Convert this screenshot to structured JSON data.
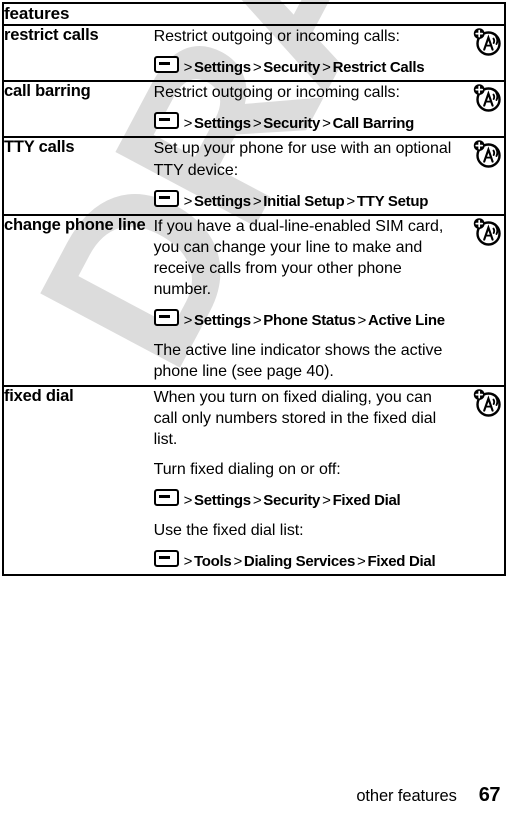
{
  "document": {
    "watermark": "DRAFT",
    "watermark_color": "#dcdcdc",
    "text_color": "#000000",
    "background_color": "#ffffff"
  },
  "table": {
    "header": {
      "label": "features"
    },
    "rows": [
      {
        "feature": "restrict calls",
        "icon": "network-a-indicator-icon",
        "blocks": [
          {
            "kind": "text",
            "text": "Restrict outgoing or incoming calls:"
          },
          {
            "kind": "path",
            "crumbs": [
              "Settings",
              "Security",
              "Restrict Calls"
            ]
          }
        ]
      },
      {
        "feature": "call barring",
        "icon": "network-a-indicator-icon",
        "blocks": [
          {
            "kind": "text",
            "text": "Restrict outgoing or incoming calls:"
          },
          {
            "kind": "path",
            "crumbs": [
              "Settings",
              "Security",
              "Call Barring"
            ]
          }
        ]
      },
      {
        "feature": "TTY calls",
        "icon": "network-a-indicator-icon",
        "blocks": [
          {
            "kind": "text",
            "text": "Set up your phone for use with an optional TTY device:"
          },
          {
            "kind": "path",
            "crumbs": [
              "Settings",
              "Initial Setup",
              "TTY Setup"
            ]
          }
        ]
      },
      {
        "feature": "change phone line",
        "icon": "network-a-indicator-icon",
        "blocks": [
          {
            "kind": "text",
            "text": "If you have a dual-line-enabled SIM card, you can change your line to make and receive calls from your other phone number."
          },
          {
            "kind": "path",
            "crumbs": [
              "Settings",
              "Phone Status",
              "Active Line"
            ]
          },
          {
            "kind": "text",
            "text": "The active line indicator shows the active phone line (see page 40)."
          }
        ]
      },
      {
        "feature": "fixed dial",
        "icon": "network-a-indicator-icon",
        "blocks": [
          {
            "kind": "text",
            "text": "When you turn on fixed dialing, you can call only numbers stored in the fixed dial list."
          },
          {
            "kind": "text",
            "text": "Turn fixed dialing on or off:"
          },
          {
            "kind": "path",
            "crumbs": [
              "Settings",
              "Security",
              "Fixed Dial"
            ]
          },
          {
            "kind": "text",
            "text": "Use the fixed dial list:"
          },
          {
            "kind": "path",
            "crumbs": [
              "Tools",
              "Dialing Services",
              "Fixed Dial"
            ]
          }
        ]
      }
    ],
    "path_separator": ">"
  },
  "footer": {
    "section_title": "other features",
    "page_number": "67"
  }
}
